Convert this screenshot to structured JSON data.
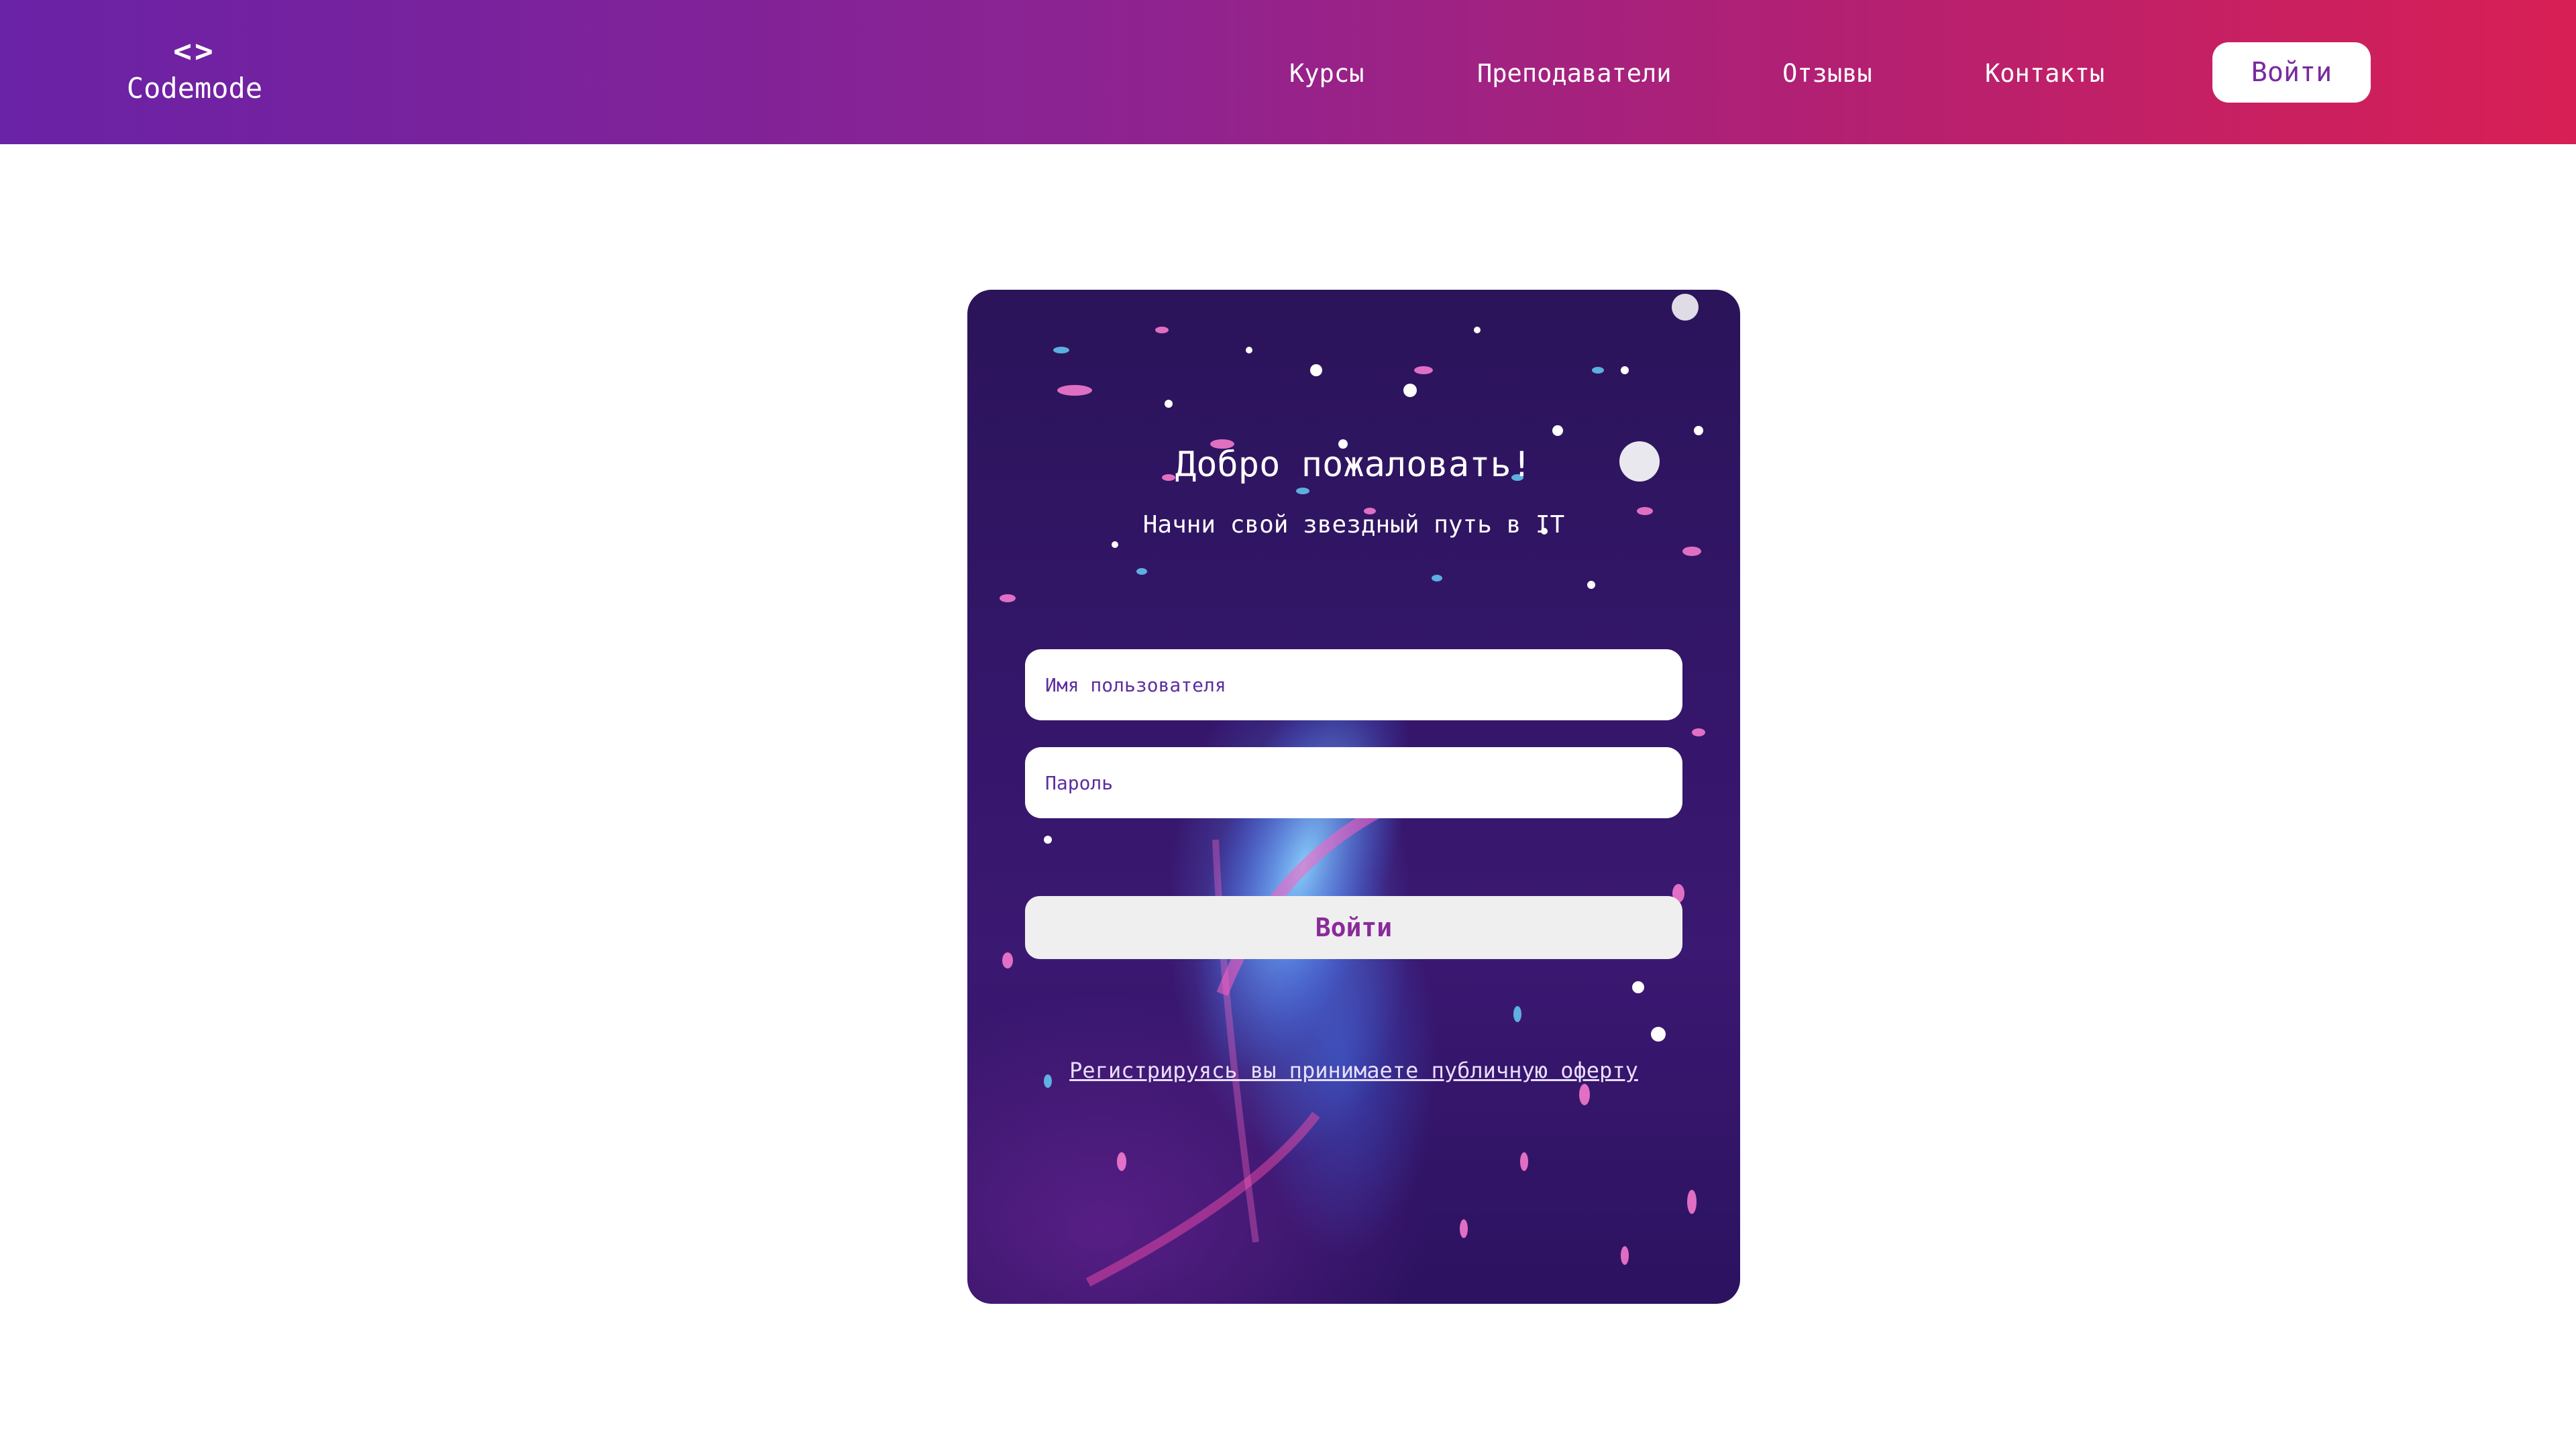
{
  "header": {
    "logo_icon": "<>",
    "logo_text": "Codemode",
    "nav": [
      {
        "label": "Курсы"
      },
      {
        "label": "Преподаватели"
      },
      {
        "label": "Отзывы"
      },
      {
        "label": "Контакты"
      }
    ],
    "login_label": "Войти"
  },
  "card": {
    "title": "Добро пожаловать!",
    "subtitle": "Начни свой звездный путь в IT",
    "username_placeholder": "Имя пользователя",
    "password_placeholder": "Пароль",
    "submit_label": "Войти",
    "offer_link": "Регистрируясь вы принимаете публичную оферту"
  },
  "colors": {
    "header_gradient_start": "#6a22a6",
    "header_gradient_end": "#d81f55",
    "card_background": "#2b145a",
    "accent": "#8a2a9a"
  },
  "icons": {
    "logo": "code-brackets-icon"
  }
}
